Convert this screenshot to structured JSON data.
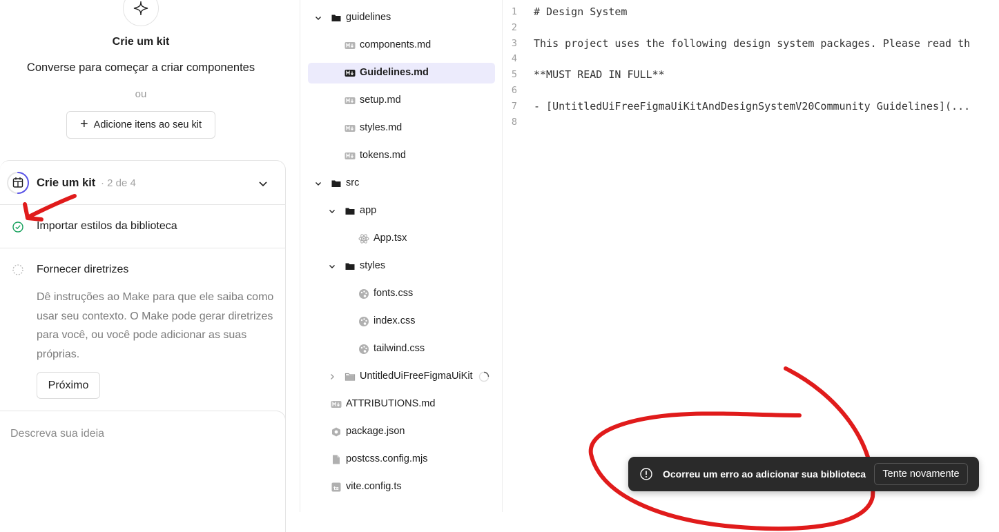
{
  "kit": {
    "title": "Crie um kit",
    "subtitle": "Converse para começar a criar componentes",
    "or": "ou",
    "add_button_label": "Adicione itens ao seu kit"
  },
  "checklist": {
    "title": "Crie um kit",
    "count": "· 2 de 4",
    "progress": 0.5,
    "steps": [
      {
        "label": "Importar estilos da biblioteca",
        "status": "done"
      },
      {
        "label": "Fornecer diretrizes",
        "status": "pending",
        "description": "Dê instruções ao Make para que ele saiba como usar seu contexto. O Make pode gerar diretrizes para você, ou você pode adicionar as suas próprias.",
        "next_button_label": "Próximo"
      }
    ]
  },
  "prompt": {
    "placeholder": "Descreva sua ideia"
  },
  "file_tree": {
    "items": [
      {
        "name": "guidelines",
        "type": "folder",
        "expanded": true
      },
      {
        "name": "components.md",
        "type": "markdown"
      },
      {
        "name": "Guidelines.md",
        "type": "markdown",
        "selected": true
      },
      {
        "name": "setup.md",
        "type": "markdown"
      },
      {
        "name": "styles.md",
        "type": "markdown"
      },
      {
        "name": "tokens.md",
        "type": "markdown"
      },
      {
        "name": "src",
        "type": "folder",
        "expanded": true
      },
      {
        "name": "app",
        "type": "folder",
        "expanded": true
      },
      {
        "name": "App.tsx",
        "type": "react"
      },
      {
        "name": "styles",
        "type": "folder",
        "expanded": true
      },
      {
        "name": "fonts.css",
        "type": "css"
      },
      {
        "name": "index.css",
        "type": "css"
      },
      {
        "name": "tailwind.css",
        "type": "css"
      },
      {
        "name": "UntitledUiFreeFigmaUiKit",
        "type": "folder",
        "expanded": false,
        "loading": true
      },
      {
        "name": "ATTRIBUTIONS.md",
        "type": "markdown"
      },
      {
        "name": "package.json",
        "type": "package"
      },
      {
        "name": "postcss.config.mjs",
        "type": "file"
      },
      {
        "name": "vite.config.ts",
        "type": "typescript"
      }
    ]
  },
  "editor": {
    "lines": [
      {
        "num": "1",
        "text": "# Design System"
      },
      {
        "num": "2",
        "text": ""
      },
      {
        "num": "3",
        "text": "This project uses the following design system packages. Please read th"
      },
      {
        "num": "4",
        "text": ""
      },
      {
        "num": "5",
        "text": "**MUST READ IN FULL**"
      },
      {
        "num": "6",
        "text": ""
      },
      {
        "num": "7",
        "text": "- [UntitledUiFreeFigmaUiKitAndDesignSystemV20Community Guidelines](..."
      },
      {
        "num": "8",
        "text": ""
      }
    ]
  },
  "toast": {
    "message": "Ocorreu um erro ao adicionar sua biblioteca",
    "retry_label": "Tente novamente"
  },
  "colors": {
    "accent": "#5b55e8",
    "selected_bg": "#ecebfc",
    "success": "#14a05a",
    "annotation_red": "#e01b1b",
    "toast_bg": "#2a2a2a"
  },
  "icons": {
    "kit_logo": "sparkle-icon",
    "checklist": "calendar-icon",
    "collapse": "chevron-down-icon",
    "done": "check-circle-icon",
    "pending": "dashed-circle-icon",
    "add": "plus-icon",
    "error": "info-circle-icon"
  }
}
